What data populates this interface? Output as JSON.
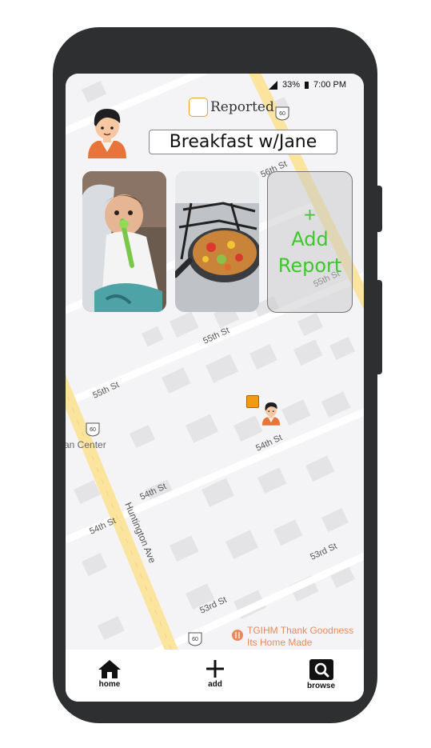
{
  "status_bar": {
    "battery": "33%",
    "time": "7:00 PM"
  },
  "report": {
    "checkbox_label": "Reported",
    "title": "Breakfast w/Jane"
  },
  "photos": [
    {
      "icon": "baby-eating-photo"
    },
    {
      "icon": "pan-on-stove-photo"
    }
  ],
  "add_report": {
    "plus": "+",
    "label": "Add Report"
  },
  "map": {
    "streets": [
      "56th St",
      "55th St",
      "55th St",
      "55th St",
      "54th St",
      "54th St",
      "54th St",
      "53rd St",
      "53rd St",
      "Huntington Ave"
    ],
    "route_shields": [
      "60",
      "60",
      "60"
    ],
    "places": [
      "an Center",
      "TGIHM Thank Goodness Its Home Made"
    ],
    "colors": {
      "highway": "#fbe49e",
      "road": "#ffffff",
      "block": "#e4e4e6",
      "place": "#e98a5c"
    }
  },
  "navbar": {
    "home": "home",
    "add": "add",
    "browse": "browse"
  }
}
